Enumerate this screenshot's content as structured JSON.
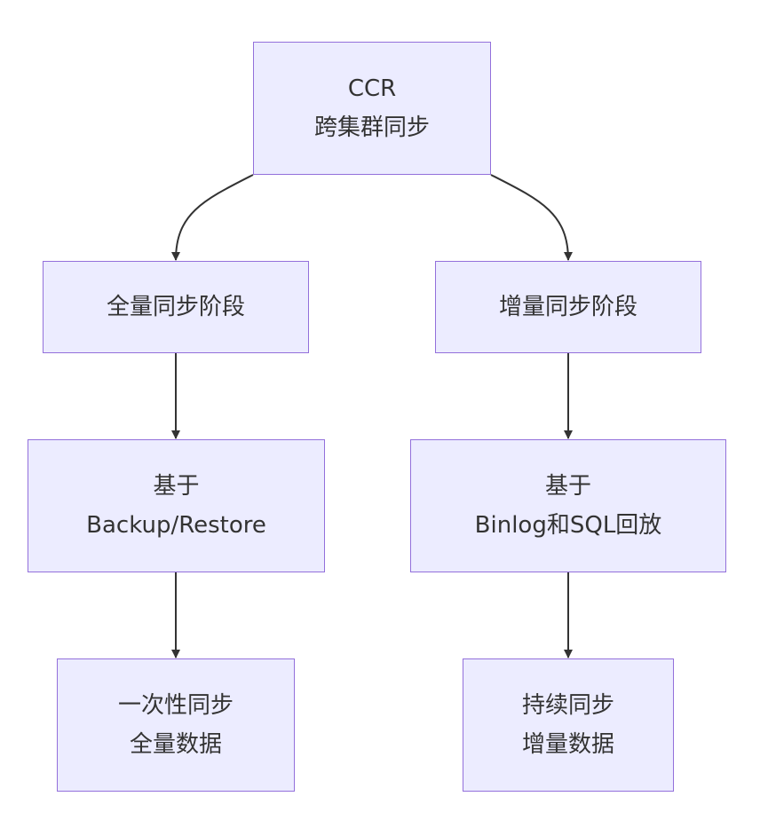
{
  "nodes": {
    "ccr": {
      "line1": "CCR",
      "line2": "跨集群同步"
    },
    "full_phase": {
      "line1": "全量同步阶段"
    },
    "incr_phase": {
      "line1": "增量同步阶段"
    },
    "backup": {
      "line1": "基于",
      "line2": "Backup/Restore"
    },
    "binlog": {
      "line1": "基于",
      "line2": "Binlog和SQL回放"
    },
    "onetime": {
      "line1": "一次性同步",
      "line2": "全量数据"
    },
    "continuous": {
      "line1": "持续同步",
      "line2": "增量数据"
    }
  },
  "colors": {
    "node_fill": "#ececff",
    "node_border": "#9370db",
    "edge": "#333333",
    "text": "#333333"
  }
}
